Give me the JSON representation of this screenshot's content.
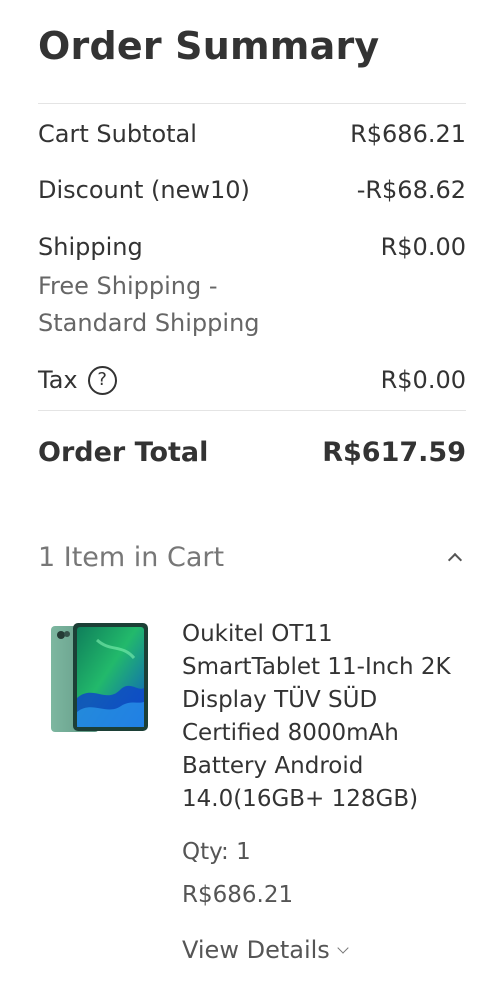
{
  "summary": {
    "title": "Order Summary",
    "subtotal_label": "Cart Subtotal",
    "subtotal_value": "R$686.21",
    "discount_label": "Discount (new10)",
    "discount_value": "-R$68.62",
    "shipping_label": "Shipping",
    "shipping_value": "R$0.00",
    "shipping_method": "Free Shipping - Standard Shipping",
    "tax_label": "Tax",
    "tax_help": "?",
    "tax_value": "R$0.00",
    "total_label": "Order Total",
    "total_value": "R$617.59"
  },
  "cart": {
    "count_label": "1 Item in Cart",
    "toggle_icon": "chevron-up-icon",
    "item": {
      "image": "tablet-product-image",
      "name": "Oukitel OT11 SmartTablet 11-Inch 2K Display TÜV SÜD Certified 8000mAh Battery Android 14.0(16GB+ 128GB)",
      "qty": "Qty: 1",
      "price": "R$686.21",
      "details_label": "View Details",
      "details_icon": "chevron-down-icon"
    }
  },
  "colors": {
    "text_primary": "#333333",
    "text_secondary": "#666666",
    "divider": "#e4e4e4",
    "tablet_body": "#6aa58f",
    "tablet_screen": "#1f9b6b"
  }
}
